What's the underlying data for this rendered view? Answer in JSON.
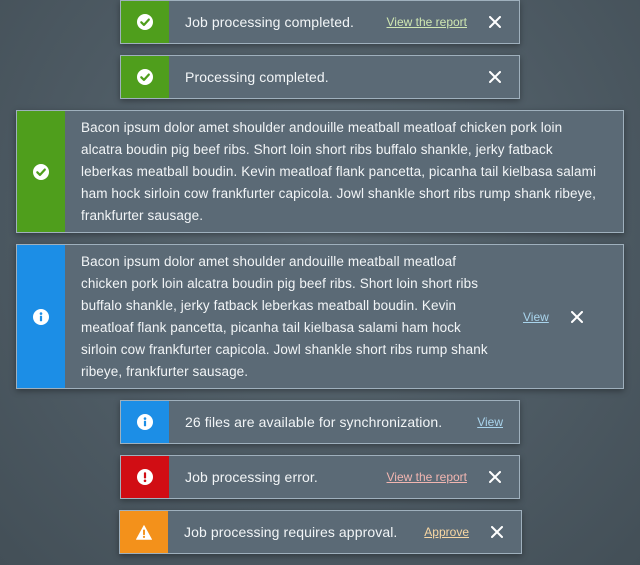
{
  "toasts": [
    {
      "type": "success",
      "message": "Job processing completed.",
      "action": "View the report",
      "icon": "check-circle-icon"
    },
    {
      "type": "success",
      "message": "Processing completed.",
      "icon": "check-circle-icon"
    },
    {
      "type": "success",
      "message": "Bacon ipsum dolor amet shoulder andouille meatball meatloaf chicken pork loin alcatra boudin pig beef ribs. Short loin short ribs buffalo shankle, jerky fatback leberkas meatball boudin. Kevin meatloaf flank pancetta, picanha tail kielbasa salami ham hock sirloin cow frankfurter capicola. Jowl shankle short ribs rump shank ribeye, frankfurter sausage.",
      "icon": "check-circle-icon"
    },
    {
      "type": "info",
      "message": "Bacon ipsum dolor amet shoulder andouille meatball meatloaf chicken pork loin alcatra boudin pig beef ribs. Short loin short ribs buffalo shankle, jerky fatback leberkas meatball boudin. Kevin meatloaf flank pancetta, picanha tail kielbasa salami ham hock sirloin cow frankfurter capicola. Jowl shankle short ribs rump shank ribeye, frankfurter sausage.",
      "action": "View",
      "icon": "info-circle-icon"
    },
    {
      "type": "info",
      "message": "26 files are available for synchronization.",
      "action": "View",
      "icon": "info-circle-icon"
    },
    {
      "type": "error",
      "message": "Job processing error.",
      "action": "View the report",
      "icon": "exclamation-circle-icon"
    },
    {
      "type": "warning",
      "message": "Job processing requires approval.",
      "action": "Approve",
      "icon": "warning-triangle-icon"
    }
  ],
  "colors": {
    "success": "#4f9e1c",
    "info": "#1c8ee6",
    "error": "#d10d14",
    "warning": "#f3911b",
    "toast_background": "#5b6a76",
    "page_background": "#4d5a63"
  }
}
